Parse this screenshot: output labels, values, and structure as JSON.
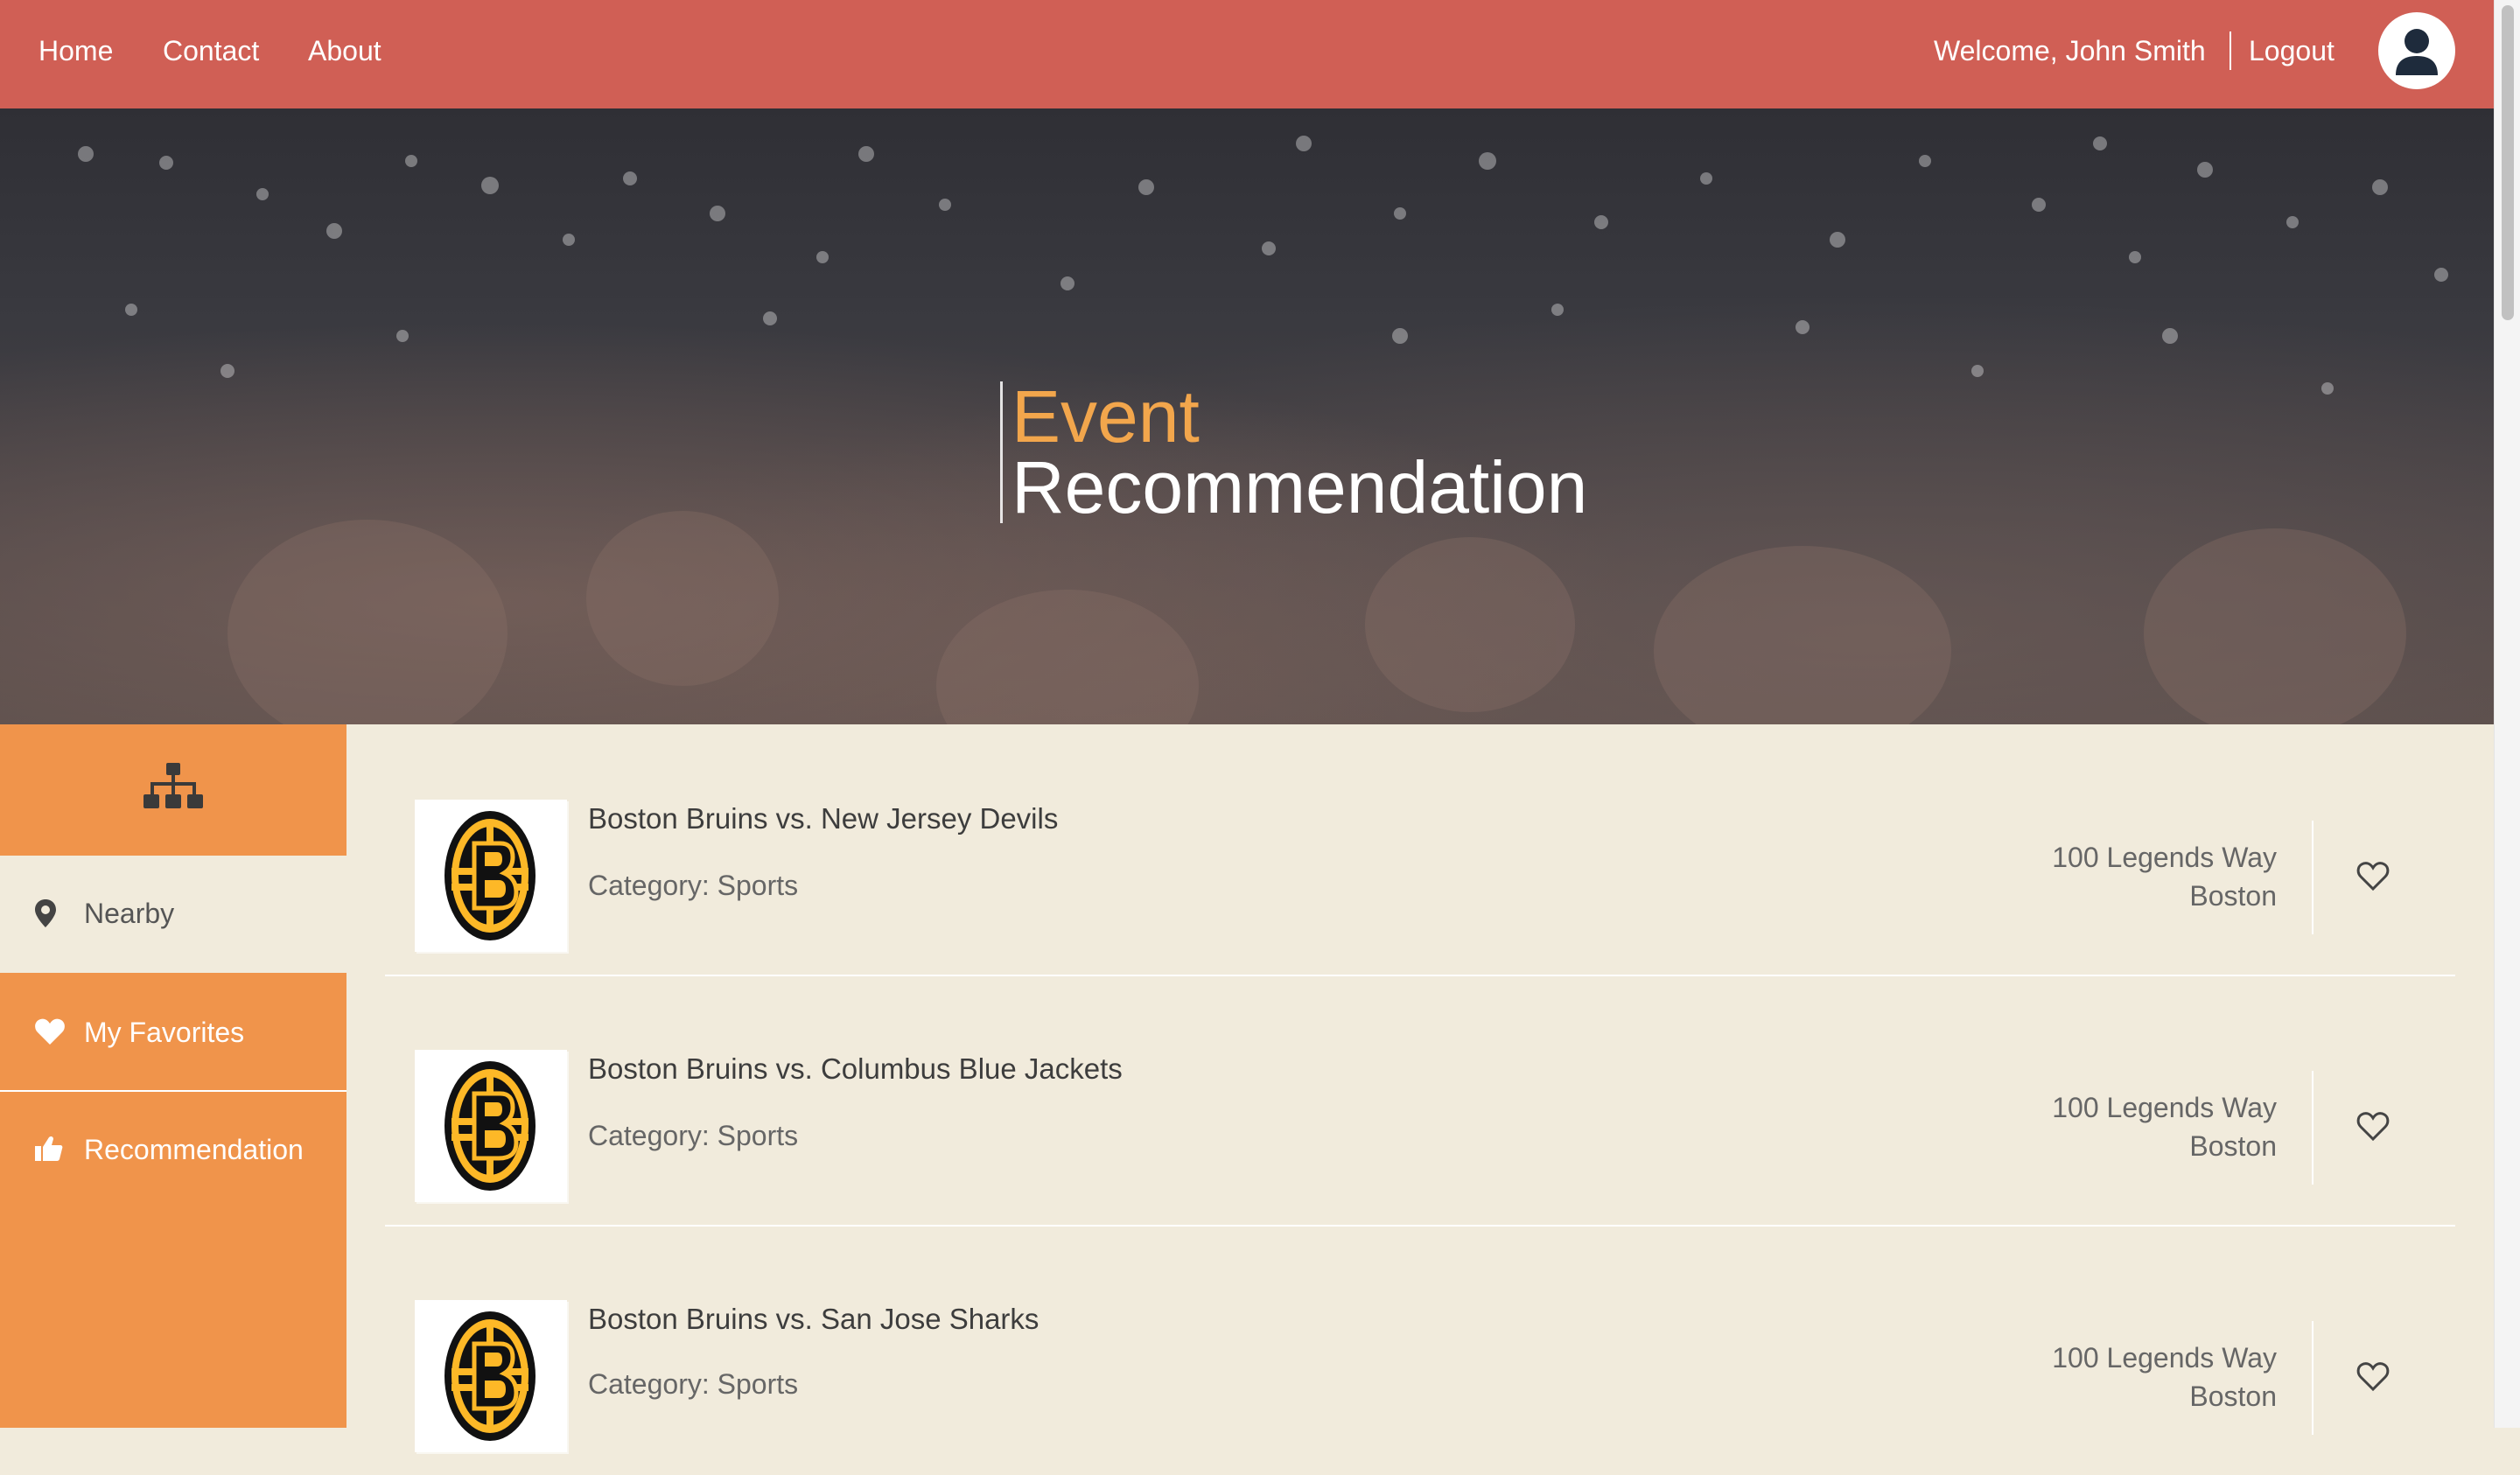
{
  "nav": {
    "links": [
      "Home",
      "Contact",
      "About"
    ],
    "welcome": "Welcome, John Smith",
    "logout": "Logout",
    "avatar_icon": "user-icon"
  },
  "hero": {
    "line1": "Event",
    "line2": "Recommendation"
  },
  "sidebar": {
    "top_icon": "sitemap-icon",
    "items": [
      {
        "label": "Nearby",
        "icon": "map-marker-icon"
      },
      {
        "label": "My Favorites",
        "icon": "heart-icon"
      },
      {
        "label": "Recommendation",
        "icon": "thumbs-up-icon"
      }
    ]
  },
  "events": [
    {
      "name": "Boston Bruins vs. New Jersey Devils",
      "category": "Category: Sports",
      "address_line1": "100 Legends Way",
      "address_line2": "Boston"
    },
    {
      "name": "Boston Bruins vs. Columbus Blue Jackets",
      "category": "Category: Sports",
      "address_line1": "100 Legends Way",
      "address_line2": "Boston"
    },
    {
      "name": "Boston Bruins vs. San Jose Sharks",
      "category": "Category: Sports",
      "address_line1": "100 Legends Way",
      "address_line2": "Boston"
    }
  ],
  "colors": {
    "topbar": "#d05f55",
    "sidebar": "#f0944b",
    "content_bg": "#f1ebdc",
    "hero_accent": "#f2a64c"
  }
}
